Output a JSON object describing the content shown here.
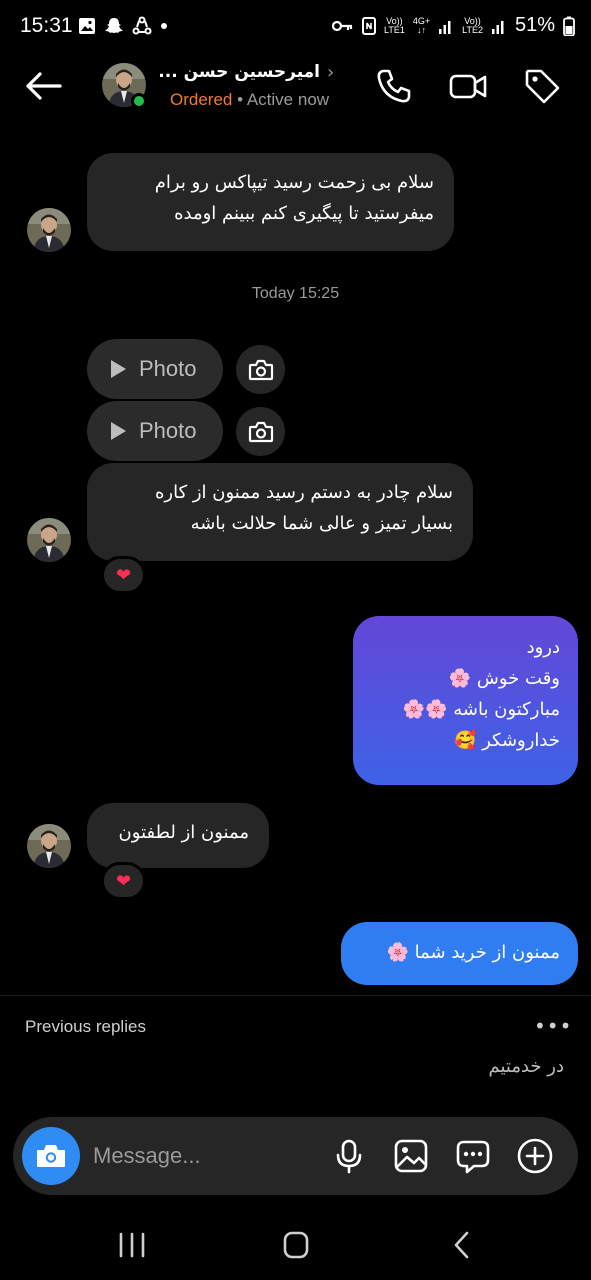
{
  "status_bar": {
    "time": "15:31",
    "lte1": "LTE1",
    "lte2": "LTE2",
    "volte": "Vo))",
    "net": "4G+",
    "battery": "51%",
    "icons": [
      "gallery-icon",
      "snapchat-icon",
      "sync-icon",
      "dot-icon",
      "key-icon",
      "nfc-icon",
      "signal-icon",
      "battery-icon"
    ]
  },
  "header": {
    "name": "امیرحسین حسن ...",
    "chevron": "›",
    "status_ordered": "Ordered",
    "status_sep": " • ",
    "status_active": "Active now",
    "icons": [
      "back-arrow-icon",
      "phone-icon",
      "video-icon",
      "tag-icon"
    ]
  },
  "messages": {
    "m1": {
      "line1": "سلام بی زحمت رسید تیپاکس رو برام",
      "line2": "میفرستید تا پیگیری کنم ببینم اومده"
    },
    "timestamp": "Today 15:25",
    "photo1": "Photo",
    "photo2": "Photo",
    "m2": {
      "line1": "سلام چادر به دستم رسید ممنون از کاره",
      "line2": "بسیار تمیز و عالی شما حلالت باشه",
      "reaction": "❤"
    },
    "m3_out": {
      "line1": "درود",
      "line2": "وقت خوش 🌸",
      "line3": "مبارکتون باشه 🌸🌸",
      "line4": "خداروشکر 🥰"
    },
    "m4": {
      "text": "ممنون از لطفتون",
      "reaction": "❤"
    },
    "m5_out": {
      "text": "ممنون از خرید شما 🌸"
    }
  },
  "colors": {
    "incoming_bubble": "#262626",
    "outgoing_gradient_top": "#6347d8",
    "outgoing_gradient_bottom": "#3e62e6",
    "outgoing_blue": "#2f7df0",
    "ordered_orange": "#f07b2a",
    "online_green": "#1fbf4a",
    "heart": "#ff2d55"
  },
  "previous_replies": {
    "title": "Previous replies",
    "more": "•••",
    "reply": "در خدمتیم"
  },
  "composer": {
    "placeholder": "Message...",
    "icons": [
      "camera-icon",
      "microphone-icon",
      "image-icon",
      "chat-sticker-icon",
      "plus-icon"
    ]
  },
  "navbar": {
    "icons": [
      "recent-apps-icon",
      "home-icon",
      "back-icon"
    ]
  }
}
